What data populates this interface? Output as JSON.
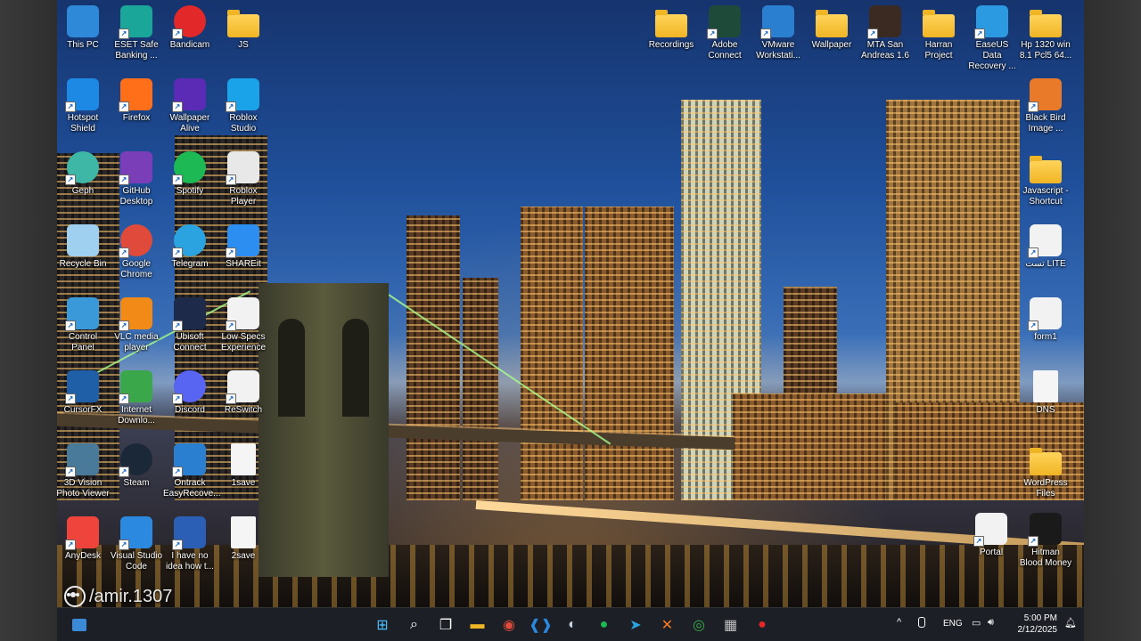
{
  "desktop": {
    "left_icons": [
      {
        "label": "This PC",
        "icon": "monitor-icon",
        "color": "#2e8ad8"
      },
      {
        "label": "ESET Safe\nBanking ...",
        "icon": "eset-icon",
        "color": "#1aa79a"
      },
      {
        "label": "Bandicam",
        "icon": "bandicam-icon",
        "color": "#e22828"
      },
      {
        "label": "JS",
        "icon": "folder-icon",
        "color": "#f0b525"
      },
      {
        "label": "Hotspot\nShield",
        "icon": "hotspot-shield-icon",
        "color": "#1e88e5"
      },
      {
        "label": "Firefox",
        "icon": "firefox-icon",
        "color": "#ff6f1a"
      },
      {
        "label": "Wallpaper\nAlive",
        "icon": "wallpaper-alive-icon",
        "color": "#5b2bb5"
      },
      {
        "label": "Roblox\nStudio",
        "icon": "roblox-studio-icon",
        "color": "#1aa3e8"
      },
      {
        "label": "Geph",
        "icon": "geph-icon",
        "color": "#3fb7a6"
      },
      {
        "label": "GitHub\nDesktop",
        "icon": "github-icon",
        "color": "#7a3fb8"
      },
      {
        "label": "Spotify",
        "icon": "spotify-icon",
        "color": "#1db954"
      },
      {
        "label": "Roblox\nPlayer",
        "icon": "roblox-icon",
        "color": "#e8e8e8"
      },
      {
        "label": "Recycle Bin",
        "icon": "recycle-bin-icon",
        "color": "#9fd0f0"
      },
      {
        "label": "Google\nChrome",
        "icon": "chrome-icon",
        "color": "#e04a3a"
      },
      {
        "label": "Telegram",
        "icon": "telegram-icon",
        "color": "#2aa3e0"
      },
      {
        "label": "SHAREit",
        "icon": "shareit-icon",
        "color": "#2b8ef0"
      },
      {
        "label": "Control\nPanel",
        "icon": "control-panel-icon",
        "color": "#3a9ad9"
      },
      {
        "label": "VLC media\nplayer",
        "icon": "vlc-icon",
        "color": "#f18a16"
      },
      {
        "label": "Ubisoft\nConnect",
        "icon": "ubisoft-icon",
        "color": "#1e2a4a"
      },
      {
        "label": "Low Specs\nExperience",
        "icon": "lse-icon",
        "color": "#f2f2f2"
      },
      {
        "label": "CursorFX",
        "icon": "cursorfx-icon",
        "color": "#1e5fa8"
      },
      {
        "label": "Internet\nDownlo...",
        "icon": "idm-icon",
        "color": "#3aa84a"
      },
      {
        "label": "Discord",
        "icon": "discord-icon",
        "color": "#5865f2"
      },
      {
        "label": "ReSwitch",
        "icon": "reswitch-icon",
        "color": "#f2f2f2"
      },
      {
        "label": "3D Vision\nPhoto Viewer",
        "icon": "photo-viewer-icon",
        "color": "#4a7a9a"
      },
      {
        "label": "Steam",
        "icon": "steam-icon",
        "color": "#1b2838"
      },
      {
        "label": "Ontrack\nEasyRecove...",
        "icon": "ontrack-icon",
        "color": "#2b7fd0"
      },
      {
        "label": "1save",
        "icon": "file-icon",
        "color": "#f5f5f5"
      },
      {
        "label": "AnyDesk",
        "icon": "anydesk-icon",
        "color": "#ef443b"
      },
      {
        "label": "Visual Studio\nCode",
        "icon": "vscode-icon",
        "color": "#2b8ae0"
      },
      {
        "label": "I have no\nidea how t...",
        "icon": "word-icon",
        "color": "#2b5fb5"
      },
      {
        "label": "2save",
        "icon": "file-icon",
        "color": "#f5f5f5"
      }
    ],
    "right_icons": [
      {
        "label": "Recordings",
        "icon": "folder-icon",
        "color": "#f0b525"
      },
      {
        "label": "Adobe\nConnect",
        "icon": "adobe-connect-icon",
        "color": "#1e4a3a"
      },
      {
        "label": "VMware\nWorkstati...",
        "icon": "vmware-icon",
        "color": "#2b7fd0"
      },
      {
        "label": "Wallpaper",
        "icon": "folder-icon",
        "color": "#f0b525"
      },
      {
        "label": "MTA San\nAndreas 1.6",
        "icon": "mta-icon",
        "color": "#3a2a22"
      },
      {
        "label": "Harran\nProject",
        "icon": "folder-icon",
        "color": "#f0b525"
      },
      {
        "label": "EaseUS Data\nRecovery ...",
        "icon": "easeus-icon",
        "color": "#2b9ae0"
      },
      {
        "label": "Hp 1320 win\n8.1 Pcl5 64...",
        "icon": "folder-icon",
        "color": "#f0b525"
      }
    ],
    "right_column": [
      {
        "label": "Black Bird\nImage ...",
        "icon": "blackbird-icon",
        "color": "#e87a2a"
      },
      {
        "label": "Javascript -\nShortcut",
        "icon": "folder-icon",
        "color": "#f0b525"
      },
      {
        "label": "تست LITE",
        "icon": "lite-icon",
        "color": "#f2f2f2"
      },
      {
        "label": "form1",
        "icon": "php-icon",
        "color": "#f2f2f2"
      },
      {
        "label": "DNS",
        "icon": "file-icon",
        "color": "#f5f5f5"
      },
      {
        "label": "WordPress\nFiles",
        "icon": "folder-icon",
        "color": "#f0b525"
      },
      {
        "label": "Portal",
        "icon": "portal-icon",
        "color": "#f2f2f2"
      },
      {
        "label": "Hitman\nBlood Money",
        "icon": "hitman-icon",
        "color": "#1a1a1a"
      }
    ]
  },
  "watermark": "/amir.1307",
  "taskbar": {
    "apps": [
      {
        "name": "windows-start-icon",
        "glyph": "⊞",
        "color": "#4cc2ff"
      },
      {
        "name": "search-icon",
        "glyph": "⌕",
        "color": "#ffffff"
      },
      {
        "name": "task-view-icon",
        "glyph": "❐",
        "color": "#ffffff"
      },
      {
        "name": "file-explorer-icon",
        "glyph": "▬",
        "color": "#f0b525"
      },
      {
        "name": "chrome-icon",
        "glyph": "◉",
        "color": "#e04a3a"
      },
      {
        "name": "vscode-icon",
        "glyph": "❰❱",
        "color": "#2b8ae0"
      },
      {
        "name": "steam-icon",
        "glyph": "◐",
        "color": "#c6d4df"
      },
      {
        "name": "spotify-icon",
        "glyph": "●",
        "color": "#1db954"
      },
      {
        "name": "telegram-icon",
        "glyph": "➤",
        "color": "#2aa3e0"
      },
      {
        "name": "xampp-icon",
        "glyph": "✕",
        "color": "#fb7a24"
      },
      {
        "name": "idm-icon",
        "glyph": "◎",
        "color": "#3aa84a"
      },
      {
        "name": "calculator-icon",
        "glyph": "▦",
        "color": "#c0c0c0"
      },
      {
        "name": "bandicam-icon",
        "glyph": "●",
        "color": "#e22828"
      }
    ],
    "tray": {
      "chevron": "^",
      "mic": "🎤",
      "lang": "ENG",
      "clock_time": "5:00 PM",
      "clock_date": "2/12/2025"
    }
  }
}
